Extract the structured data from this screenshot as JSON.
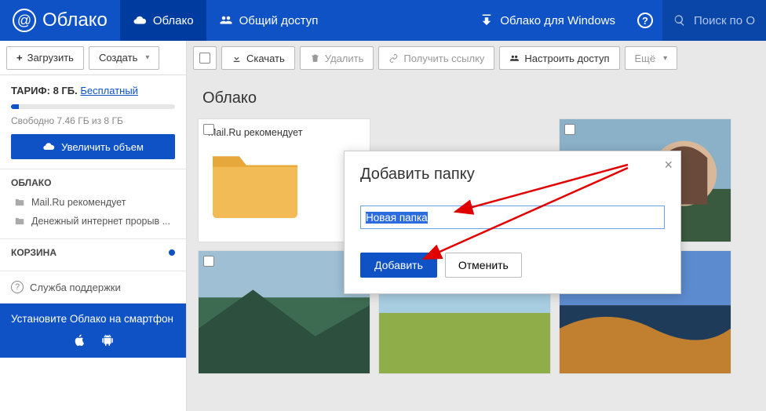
{
  "header": {
    "logo": "Облако",
    "nav": {
      "cloud": "Облако",
      "shared": "Общий доступ",
      "desktop": "Облако для Windows"
    },
    "search_placeholder": "Поиск по О"
  },
  "toolbar_left": {
    "upload": "Загрузить",
    "create": "Создать"
  },
  "toolbar_right": {
    "download": "Скачать",
    "delete": "Удалить",
    "get_link": "Получить ссылку",
    "configure_access": "Настроить доступ",
    "more": "Ещё"
  },
  "sidebar": {
    "plan_label": "ТАРИФ:",
    "plan_value": "8 ГБ.",
    "plan_link": "Бесплатный",
    "storage_free_text": "Свободно 7.46 ГБ из 8 ГБ",
    "increase_btn": "Увеличить объем",
    "cloud_heading": "ОБЛАКО",
    "items": [
      {
        "label": "Mail.Ru рекомендует"
      },
      {
        "label": "Денежный интернет прорыв ..."
      }
    ],
    "trash_heading": "КОРЗИНА",
    "support": "Служба поддержки",
    "promo": "Установите Облако на смартфон"
  },
  "content": {
    "breadcrumb": "Облако",
    "recommend_title": "Mail.Ru рекомендует"
  },
  "dialog": {
    "title": "Добавить папку",
    "input_value": "Новая папка",
    "add": "Добавить",
    "cancel": "Отменить"
  }
}
